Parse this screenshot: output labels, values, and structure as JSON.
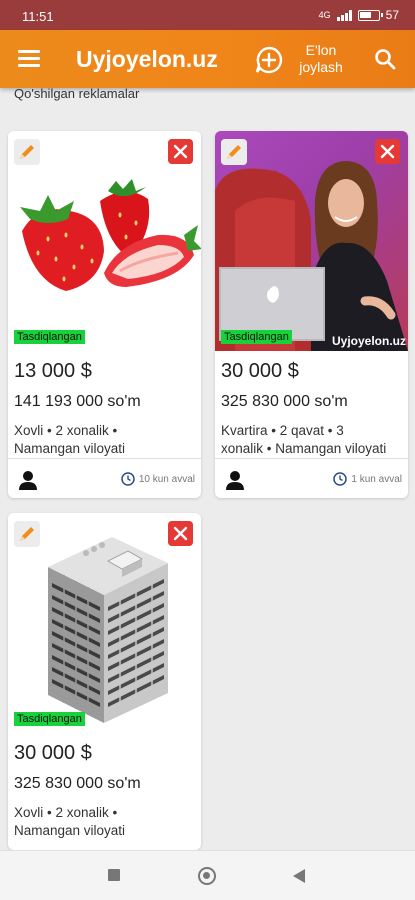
{
  "status_bar": {
    "time": "11:51",
    "network": "4G",
    "battery": "57"
  },
  "header": {
    "title": "Uyjoyelon.uz",
    "post_label_1": "E'lon",
    "post_label_2": "joylash"
  },
  "section_title": "Qo'shilgan reklamalar",
  "colors": {
    "header": "#f0861a",
    "status_bar": "#9b3c3c",
    "badge": "#18d23b",
    "delete": "#e53935"
  },
  "listings": [
    {
      "badge": "Tasdiqlangan",
      "price": "13 000 $",
      "price_som": "141 193 000 so'm",
      "details_1": "Xovli • 2 xonalik •",
      "details_2": "Namangan viloyati",
      "time": "10 kun avval",
      "photo": "strawberries"
    },
    {
      "badge": "Tasdiqlangan",
      "watermark": "Uyjoyelon.uz",
      "price": "30 000 $",
      "price_som": "325 830 000 so'm",
      "details_1": "Kvartira • 2 qavat • 3",
      "details_2": "xonalik • Namangan viloyati",
      "time": "1 kun avval",
      "photo": "woman-with-laptop"
    },
    {
      "badge": "Tasdiqlangan",
      "price": "30 000 $",
      "price_som": "325 830 000 so'm",
      "details_1": "Xovli • 2 xonalik •",
      "details_2": "Namangan viloyati",
      "photo": "isometric-building"
    }
  ]
}
